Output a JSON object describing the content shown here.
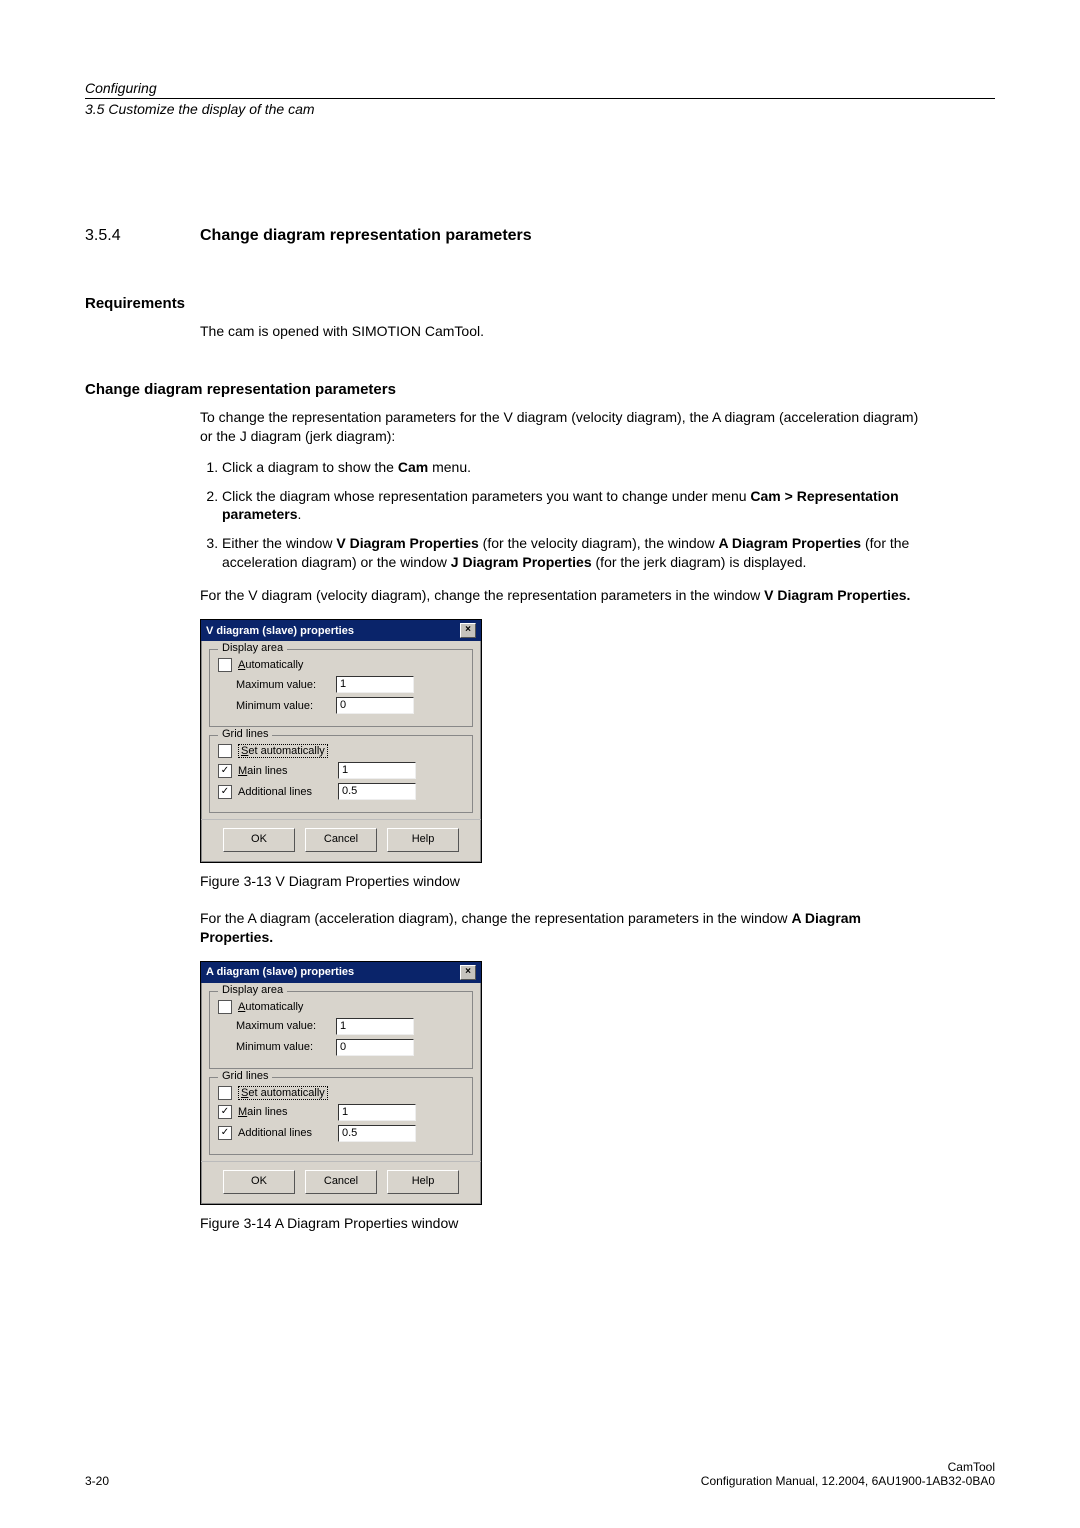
{
  "header": {
    "top": "Configuring",
    "sub": "3.5 Customize the display of the cam"
  },
  "section": {
    "number": "3.5.4",
    "title": "Change diagram representation parameters"
  },
  "req": {
    "heading": "Requirements",
    "text": "The cam is opened with SIMOTION CamTool."
  },
  "proc": {
    "heading": "Change diagram representation parameters",
    "intro": "To change the representation parameters for the V diagram (velocity diagram), the A diagram (acceleration diagram) or the J diagram (jerk diagram):",
    "step1_a": "Click a diagram to show the ",
    "step1_b": "Cam",
    "step1_c": " menu.",
    "step2_a": "Click the diagram whose representation parameters you want to change under menu ",
    "step2_b": "Cam > Representation parameters",
    "step2_c": ".",
    "step3_a": "Either the window ",
    "step3_b": "V Diagram Properties",
    "step3_c": " (for the velocity diagram), the window ",
    "step3_d": "A Diagram Properties",
    "step3_e": " (for the acceleration diagram) or the window ",
    "step3_f": "J Diagram Properties",
    "step3_g": " (for the jerk diagram) is displayed.",
    "para_v_a": "For the V diagram (velocity diagram), change the representation parameters in the window ",
    "para_v_b": "V Diagram Properties.",
    "para_a_a": "For the A diagram (acceleration diagram), change the representation parameters in the window ",
    "para_a_b": "A Diagram Properties."
  },
  "dialog1": {
    "title": "V diagram (slave) properties",
    "grp1": "Display area",
    "auto": "Automatically",
    "maxlabel": "Maximum value:",
    "maxval": "1",
    "minlabel": "Minimum value:",
    "minval": "0",
    "grp2": "Grid lines",
    "setauto": "Set automatically",
    "main": "Main lines",
    "mainval": "1",
    "addl": "Additional lines",
    "addlval": "0.5",
    "ok": "OK",
    "cancel": "Cancel",
    "help": "Help",
    "close": "×"
  },
  "dialog2": {
    "title": "A diagram (slave) properties",
    "grp1": "Display area",
    "auto": "Automatically",
    "maxlabel": "Maximum value:",
    "maxval": "1",
    "minlabel": "Minimum value:",
    "minval": "0",
    "grp2": "Grid lines",
    "setauto": "Set automatically",
    "main": "Main lines",
    "mainval": "1",
    "addl": "Additional lines",
    "addlval": "0.5",
    "ok": "OK",
    "cancel": "Cancel",
    "help": "Help",
    "close": "×"
  },
  "fig1": "Figure 3-13     V Diagram Properties window",
  "fig2": "Figure 3-14     A Diagram Properties window",
  "footer": {
    "left": "3-20",
    "right1": "CamTool",
    "right2": "Configuration Manual, 12.2004, 6AU1900-1AB32-0BA0"
  }
}
